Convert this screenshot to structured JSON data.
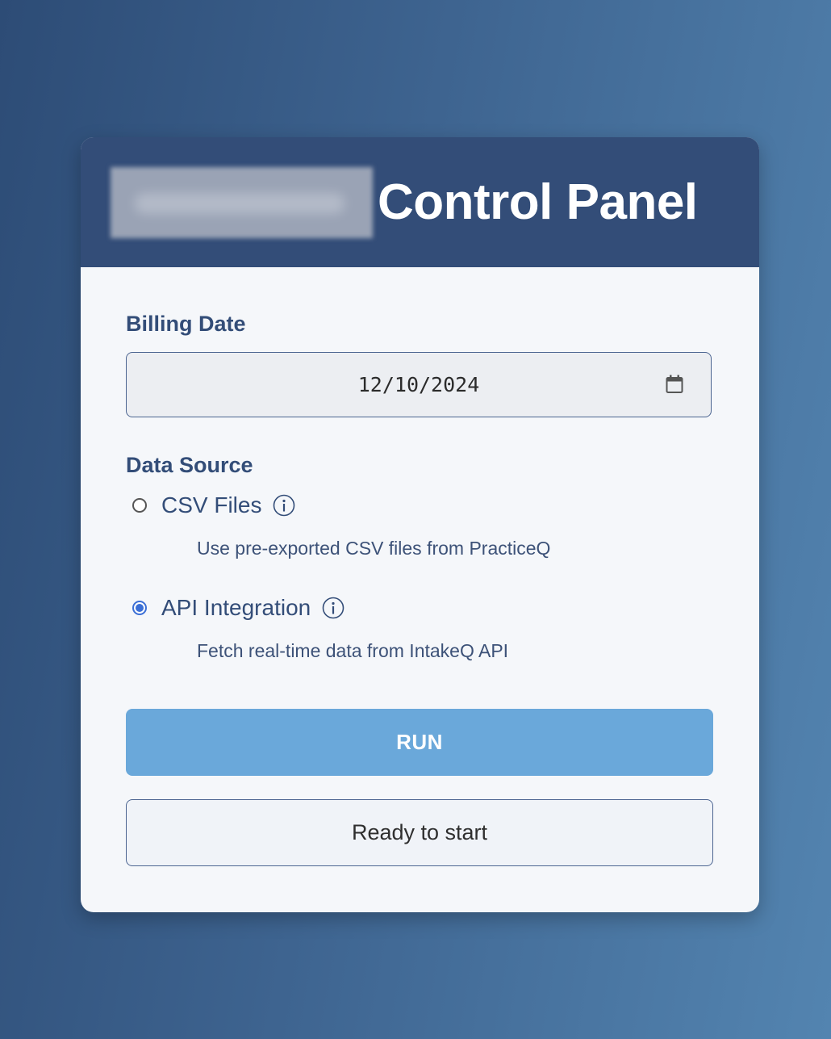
{
  "header": {
    "title": "Control Panel"
  },
  "billing_date": {
    "label": "Billing Date",
    "value": "12/10/2024",
    "icon": "calendar-icon"
  },
  "data_source": {
    "label": "Data Source",
    "options": [
      {
        "label": "CSV Files",
        "description": "Use pre-exported CSV files from PracticeQ",
        "selected": false,
        "icon": "info-icon"
      },
      {
        "label": "API Integration",
        "description": "Fetch real-time data from IntakeQ API",
        "selected": true,
        "icon": "info-icon"
      }
    ]
  },
  "run_button": {
    "label": "RUN"
  },
  "status": {
    "text": "Ready to start"
  },
  "colors": {
    "header_bg": "#334d78",
    "accent": "#3b6fd6",
    "run_button": "#6aa8da"
  }
}
